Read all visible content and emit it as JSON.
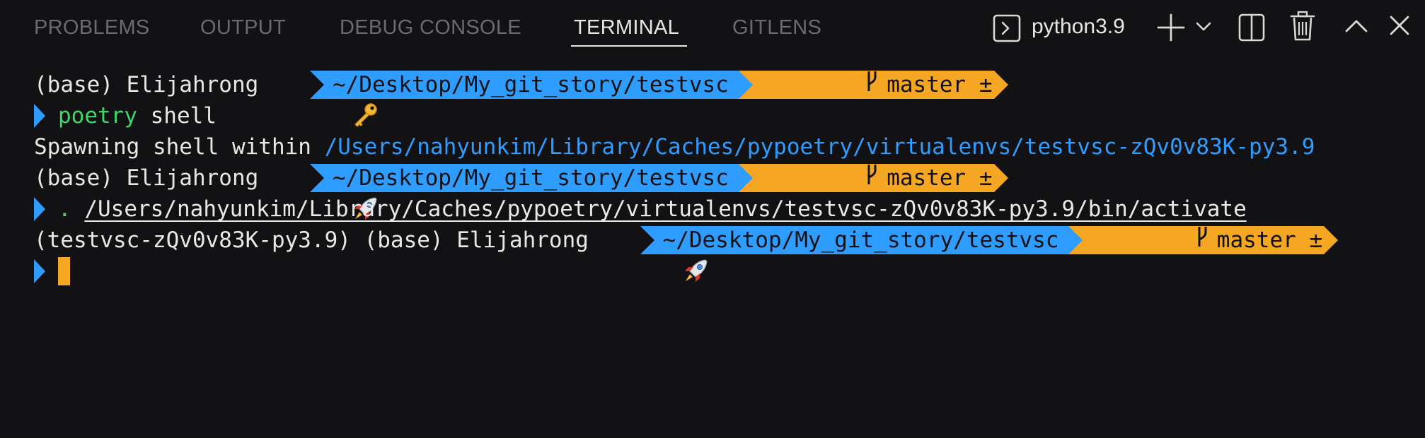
{
  "tabs": [
    {
      "label": "PROBLEMS",
      "active": false
    },
    {
      "label": "OUTPUT",
      "active": false
    },
    {
      "label": "DEBUG CONSOLE",
      "active": false
    },
    {
      "label": "TERMINAL",
      "active": true
    },
    {
      "label": "GITLENS",
      "active": false
    }
  ],
  "toolbar": {
    "shell_icon": "terminal-icon",
    "shell_name": "python3.9",
    "icons": [
      "terminal-icon",
      "plus-icon",
      "chevron-down-icon",
      "split-icon",
      "trash-icon",
      "chevron-up-icon",
      "close-icon"
    ]
  },
  "terminal": {
    "line1": {
      "env": "(base)",
      "user": " Elijahrong ",
      "emoji": "key-emoji",
      "dir": "~/Desktop/My_git_story/testvsc",
      "branch": "master ±"
    },
    "line2": {
      "cmd": "poetry",
      "rest": " shell"
    },
    "line3": {
      "text": "Spawning shell within ",
      "path": "/Users/nahyunkim/Library/Caches/pypoetry/virtualenvs/testvsc-zQv0v83K-py3.9"
    },
    "line4": {
      "env": "(base)",
      "user": " Elijahrong ",
      "emoji": "rocket-emoji",
      "dir": "~/Desktop/My_git_story/testvsc",
      "branch": "master ±"
    },
    "line5": {
      "dot": ".",
      "path": "/Users/nahyunkim/Library/Caches/pypoetry/virtualenvs/testvsc-zQv0v83K-py3.9/bin/activate"
    },
    "line6": {
      "venv": "(testvsc-zQv0v83K-py3.9)",
      "env": " (base)",
      "user": " Elijahrong ",
      "emoji": "rocket-emoji",
      "dir": "~/Desktop/My_git_story/testvsc",
      "branch": "master ±"
    }
  },
  "colors": {
    "background": "#121214",
    "accent_blue": "#2f9cff",
    "accent_orange": "#f5a623",
    "command_green": "#3fd66a"
  }
}
